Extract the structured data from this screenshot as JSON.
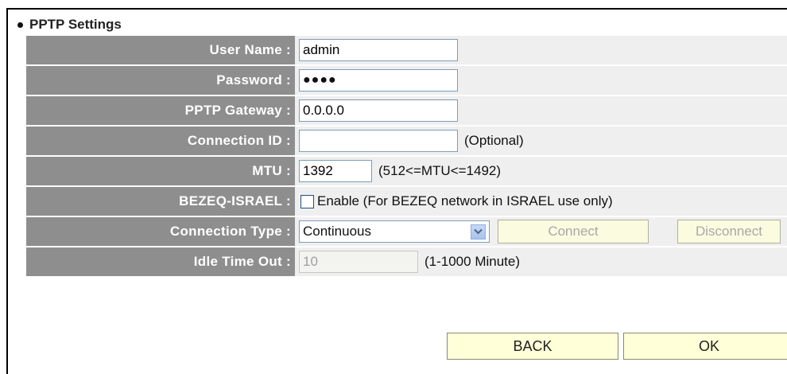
{
  "section": {
    "title": "PPTP Settings"
  },
  "fields": {
    "user_name": {
      "label": "User Name :",
      "value": "admin"
    },
    "password": {
      "label": "Password :",
      "masked_value": "●●●●"
    },
    "gateway": {
      "label": "PPTP Gateway :",
      "value": "0.0.0.0"
    },
    "connection_id": {
      "label": "Connection ID :",
      "value": "",
      "hint": "(Optional)"
    },
    "mtu": {
      "label": "MTU :",
      "value": "1392",
      "hint": "(512<=MTU<=1492)"
    },
    "bezeq": {
      "label": "BEZEQ-ISRAEL :",
      "checked": false,
      "option_text": "Enable (For BEZEQ network in ISRAEL use only)"
    },
    "connection_type": {
      "label": "Connection Type :",
      "selected": "Continuous",
      "connect_label": "Connect",
      "disconnect_label": "Disconnect"
    },
    "idle_timeout": {
      "label": "Idle Time Out :",
      "value": "10",
      "hint": "(1-1000 Minute)"
    }
  },
  "actions": {
    "back_label": "BACK",
    "ok_label": "OK"
  },
  "colors": {
    "label_bg": "#8e8e8e",
    "value_bg": "#efefef",
    "button_bg": "#ffffd8",
    "input_border": "#7f9db9"
  },
  "icons": {
    "dropdown": "chevron-down-icon",
    "bullet": "bullet-icon"
  }
}
